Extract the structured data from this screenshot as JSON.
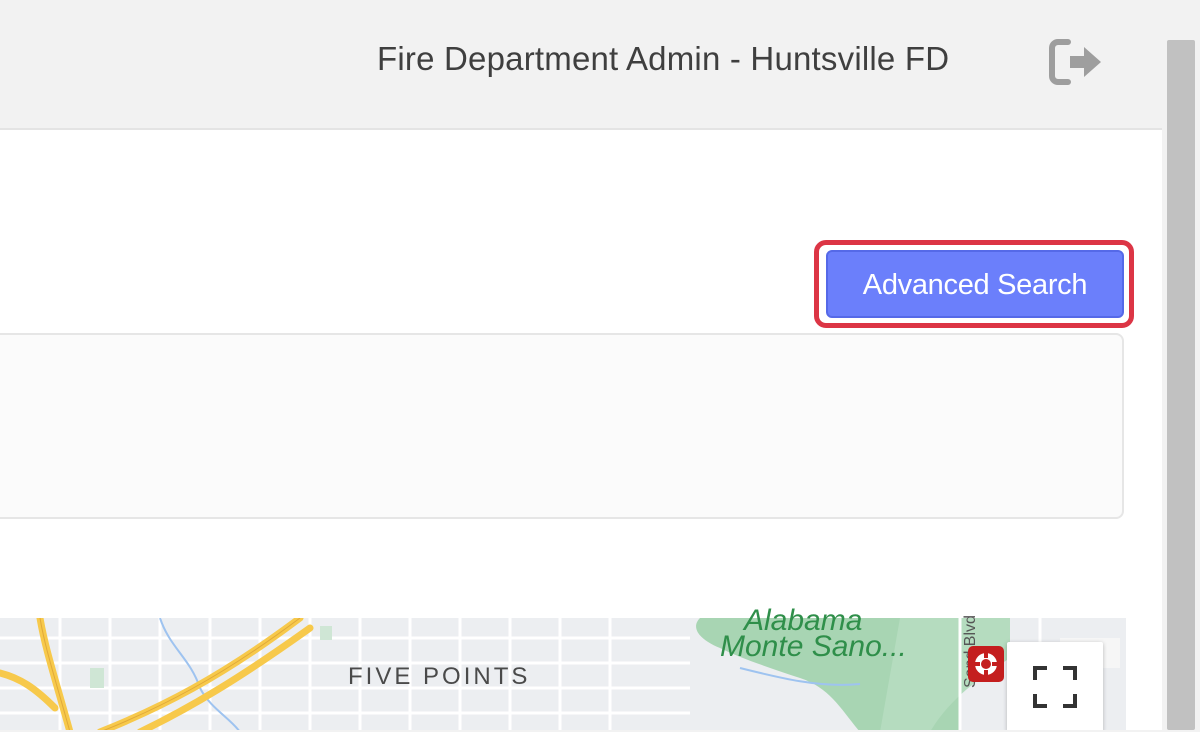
{
  "header": {
    "title": "Fire Department Admin - Huntsville FD",
    "logout_icon": "sign-out-icon"
  },
  "toolbar": {
    "advanced_search_label": "Advanced Search"
  },
  "map": {
    "labels": {
      "neighborhood": "FIVE POINTS",
      "park_line1": "Alabama",
      "park_line2": "Monte Sano...",
      "road": "Sand Blvd"
    },
    "fullscreen_icon": "fullscreen-icon",
    "poi_icon": "fire-station-icon"
  },
  "colors": {
    "primary_button": "#6b7ffb",
    "highlight_border": "#dc3545",
    "park_green": "#a8d5b3",
    "highway": "#f7c94b"
  }
}
